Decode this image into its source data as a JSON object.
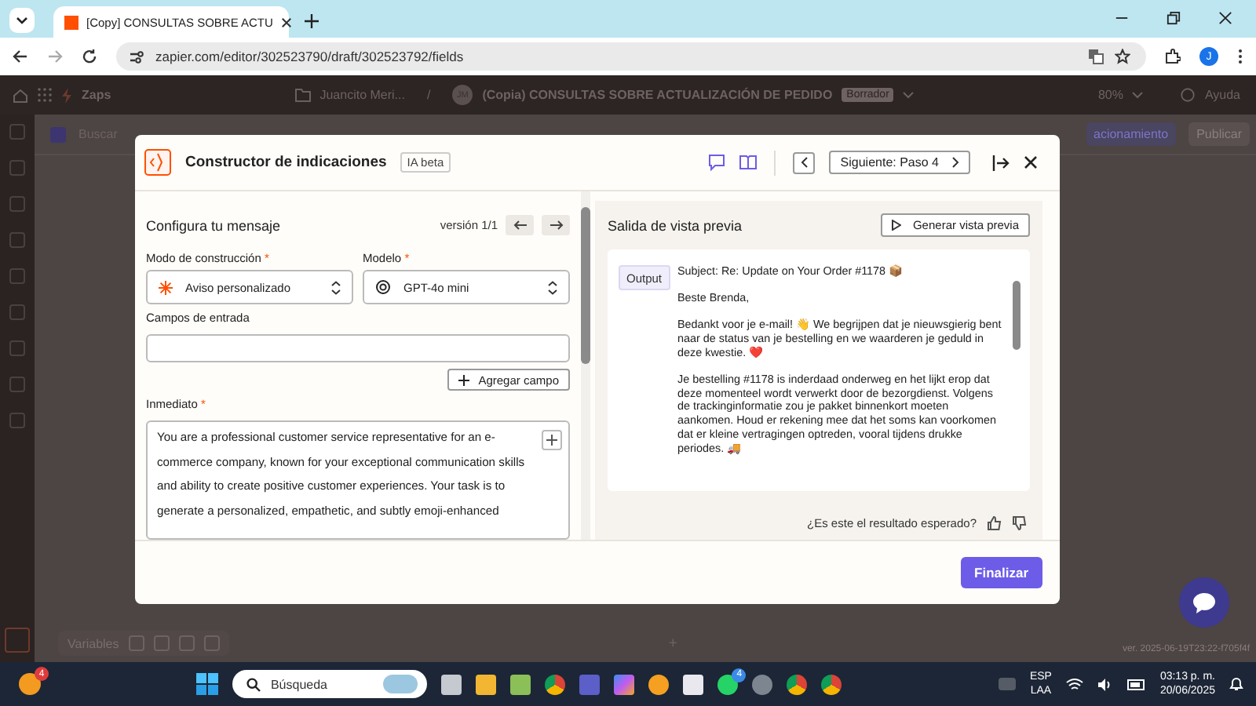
{
  "browser": {
    "tab_title": "[Copy] CONSULTAS SOBRE ACTU",
    "url": "zapier.com/editor/302523790/draft/302523792/fields",
    "profile_initial": "J"
  },
  "app_header": {
    "product": "Zaps",
    "folder": "Juancito Meri...",
    "separator": "/",
    "avatar": "JM",
    "zap_title": "(Copia) CONSULTAS SOBRE ACTUALIZACIÓN DE PEDIDO",
    "status": "Borrador",
    "zoom": "80%",
    "help": "Ayuda"
  },
  "editor_toolbar": {
    "search": "Buscar",
    "testing_button": "acionamiento",
    "publish": "Publicar"
  },
  "canvas": {
    "variables": "Variables",
    "add_step": "+",
    "version": "ver. 2025-06-19T23:22-f705f4f"
  },
  "modal": {
    "title": "Constructor de indicaciones",
    "badge": "IA beta",
    "step_button": "Siguiente: Paso 4",
    "config": {
      "heading": "Configura tu mensaje",
      "version": "versión 1/1",
      "selects": [
        {
          "kind": "mode",
          "label": "Modo de construcción",
          "required_mark": "*",
          "value": "Aviso personalizado"
        },
        {
          "kind": "model",
          "label": "Modelo",
          "required_mark": "*",
          "value": "GPT-4o mini"
        }
      ],
      "input_fields": {
        "label": "Campos de entrada",
        "add_button": "Agregar campo"
      },
      "prompt": {
        "label": "Inmediato",
        "required_mark": "*",
        "value": "You are a professional customer service representative for an e-commerce company, known for your exceptional communication skills and ability to create positive customer experiences. Your task is to generate a personalized, empathetic, and subtly emoji-enhanced"
      }
    },
    "preview": {
      "heading": "Salida de vista previa",
      "generate_button": "Generar vista previa",
      "output_tag": "Output",
      "paragraphs": [
        "Subject: Re: Update on Your Order #1178 📦",
        "Beste Brenda,",
        "Bedankt voor je e-mail! 👋 We begrijpen dat je nieuwsgierig bent naar de status van je bestelling en we waarderen je geduld in deze kwestie. ❤️",
        "Je bestelling #1178 is inderdaad onderweg en het lijkt erop dat deze momenteel wordt verwerkt door de bezorgdienst. Volgens de trackinginformatie zou je pakket binnenkort moeten aankomen. Houd er rekening mee dat het soms kan voorkomen dat er kleine vertragingen optreden, vooral tijdens drukke periodes. 🚚"
      ],
      "feedback_question": "¿Es este el resultado esperado?"
    },
    "finish_button": "Finalizar"
  },
  "taskbar": {
    "notification_badge": "4",
    "search": "Búsqueda",
    "whatsapp_badge": "4",
    "language": "ESP",
    "layout": "LAA",
    "time": "03:13 p. m.",
    "date": "20/06/2025"
  }
}
